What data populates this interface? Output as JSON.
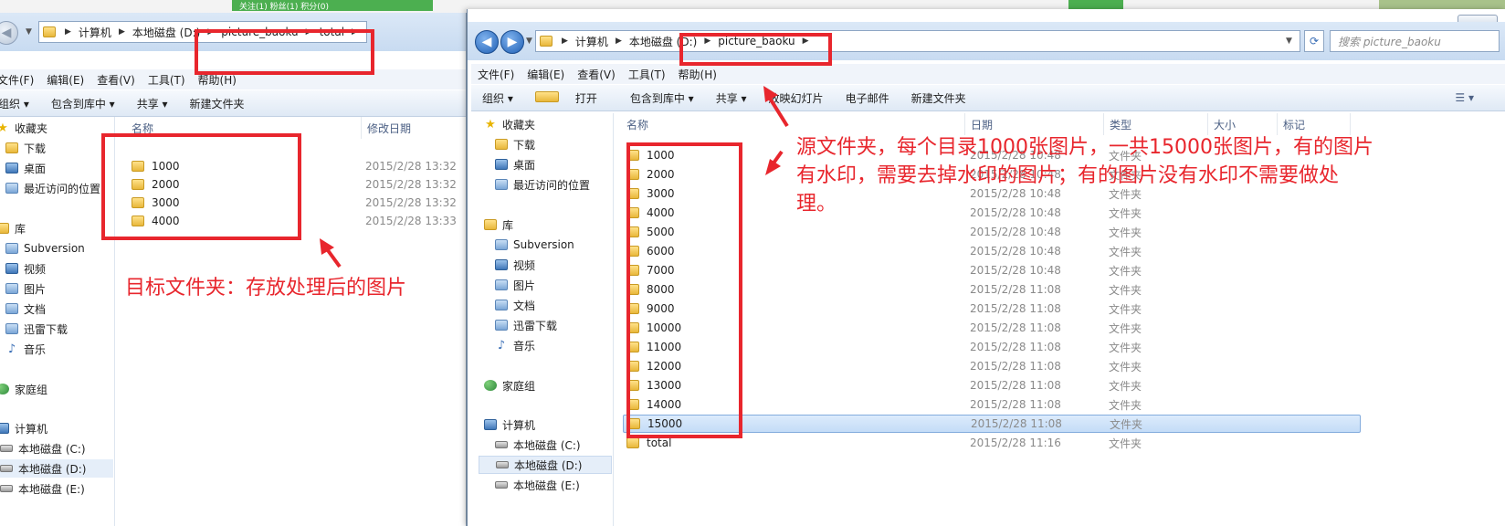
{
  "background": {
    "green_tab_text": "关注(1) 粉丝(1) 积分(0)"
  },
  "left_window": {
    "breadcrumb": [
      "计算机",
      "本地磁盘 (D:)",
      "picture_baoku",
      "total"
    ],
    "menu": [
      "文件(F)",
      "编辑(E)",
      "查看(V)",
      "工具(T)",
      "帮助(H)"
    ],
    "toolbar": [
      "组织 ▾",
      "包含到库中 ▾",
      "共享 ▾",
      "新建文件夹"
    ],
    "nav": {
      "favorites": "收藏夹",
      "fav_items": [
        "下载",
        "桌面",
        "最近访问的位置"
      ],
      "libraries": "库",
      "lib_items": [
        "Subversion",
        "视频",
        "图片",
        "文档",
        "迅雷下载",
        "音乐"
      ],
      "homegroup": "家庭组",
      "computer": "计算机",
      "drives": [
        "本地磁盘 (C:)",
        "本地磁盘 (D:)",
        "本地磁盘 (E:)"
      ]
    },
    "columns": {
      "name": "名称",
      "date": "修改日期"
    },
    "rows": [
      {
        "name": "1000",
        "date": "2015/2/28 13:32"
      },
      {
        "name": "2000",
        "date": "2015/2/28 13:32"
      },
      {
        "name": "3000",
        "date": "2015/2/28 13:32"
      },
      {
        "name": "4000",
        "date": "2015/2/28 13:33"
      }
    ]
  },
  "right_window": {
    "breadcrumb": [
      "计算机",
      "本地磁盘 (D:)",
      "picture_baoku"
    ],
    "search_placeholder": "搜索 picture_baoku",
    "menu": [
      "文件(F)",
      "编辑(E)",
      "查看(V)",
      "工具(T)",
      "帮助(H)"
    ],
    "toolbar": [
      "组织 ▾",
      "打开",
      "包含到库中 ▾",
      "共享 ▾",
      "放映幻灯片",
      "电子邮件",
      "新建文件夹"
    ],
    "nav": {
      "favorites": "收藏夹",
      "fav_items": [
        "下载",
        "桌面",
        "最近访问的位置"
      ],
      "libraries": "库",
      "lib_items": [
        "Subversion",
        "视频",
        "图片",
        "文档",
        "迅雷下载",
        "音乐"
      ],
      "homegroup": "家庭组",
      "computer": "计算机",
      "drives": [
        "本地磁盘 (C:)",
        "本地磁盘 (D:)",
        "本地磁盘 (E:)"
      ]
    },
    "columns": {
      "name": "名称",
      "date": "日期",
      "type": "类型",
      "size": "大小",
      "tags": "标记"
    },
    "rows": [
      {
        "name": "1000",
        "date": "2015/2/28 10:48",
        "type": "文件夹"
      },
      {
        "name": "2000",
        "date": "2015/2/28 10:48",
        "type": "文件夹"
      },
      {
        "name": "3000",
        "date": "2015/2/28 10:48",
        "type": "文件夹"
      },
      {
        "name": "4000",
        "date": "2015/2/28 10:48",
        "type": "文件夹"
      },
      {
        "name": "5000",
        "date": "2015/2/28 10:48",
        "type": "文件夹"
      },
      {
        "name": "6000",
        "date": "2015/2/28 10:48",
        "type": "文件夹"
      },
      {
        "name": "7000",
        "date": "2015/2/28 10:48",
        "type": "文件夹"
      },
      {
        "name": "8000",
        "date": "2015/2/28 11:08",
        "type": "文件夹"
      },
      {
        "name": "9000",
        "date": "2015/2/28 11:08",
        "type": "文件夹"
      },
      {
        "name": "10000",
        "date": "2015/2/28 11:08",
        "type": "文件夹"
      },
      {
        "name": "11000",
        "date": "2015/2/28 11:08",
        "type": "文件夹"
      },
      {
        "name": "12000",
        "date": "2015/2/28 11:08",
        "type": "文件夹"
      },
      {
        "name": "13000",
        "date": "2015/2/28 11:08",
        "type": "文件夹"
      },
      {
        "name": "14000",
        "date": "2015/2/28 11:08",
        "type": "文件夹"
      },
      {
        "name": "15000",
        "date": "2015/2/28 11:08",
        "type": "文件夹"
      },
      {
        "name": "total",
        "date": "2015/2/28 11:16",
        "type": "文件夹"
      }
    ],
    "selected_row": "15000"
  },
  "annotations": {
    "target_note": "目标文件夹：存放处理后的图片",
    "source_note_lines": [
      "源文件夹，每个目录1000张图片，一共15000张图片，有的图片",
      "有水印，需要去掉水印的图片；有的图片没有水印不需要做处",
      "理。"
    ],
    "color": "#e8262d"
  }
}
